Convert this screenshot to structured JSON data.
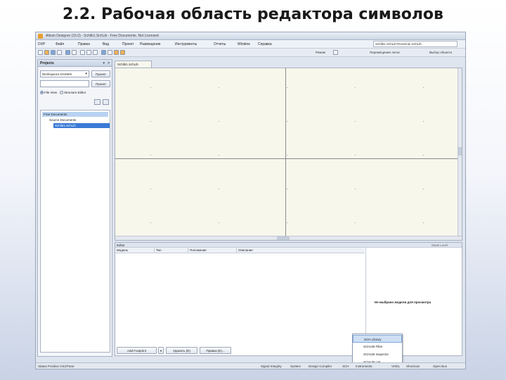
{
  "slide": {
    "title": "2.2. Рабочая область редактора символов"
  },
  "window": {
    "title": "Altium Designer (15.0) - Schlib1.SchLib - Free Documents. Not Licensed"
  },
  "menubar": {
    "items": [
      "DXP",
      "Файл",
      "Правка",
      "Вид",
      "Проект",
      "Размещение",
      "Инструменты",
      "Отчеты",
      "Window",
      "Справка"
    ],
    "path": "Schlib1.SchLib?DocKind=SchLib"
  },
  "toolbar": {
    "scheme_label": "Режим",
    "vis_label": "Перемещение легое",
    "filter_label": "Выбор объекта"
  },
  "projects_panel": {
    "title": "Projects",
    "workspace": "Workspace1.DsnWrk",
    "workspace_button": "Проект",
    "project_button": "Проект",
    "radio_file_view": "File View",
    "radio_structure": "Structure Editor",
    "tree": [
      "Free Documents",
      "Source Documents",
      "Schlib1.SchLib"
    ]
  },
  "document": {
    "tab": "Schlib1.SchLib"
  },
  "editor": {
    "header": "Editor",
    "mask_label": "Mask Level",
    "columns": [
      "Модель",
      "Тип",
      "Положение",
      "Описание"
    ],
    "preview_message": "Не выбрано модели для просмотра",
    "buttons": [
      "Add Footprint",
      "Удалить (D)",
      "Правка (E)..."
    ]
  },
  "popup_menu": {
    "items": [
      "SCH Library",
      "SCHLIB Filter",
      "SCHLIB Inspector",
      "SCHLIB List"
    ]
  },
  "statusbar": {
    "left": "Status  Position  Grid:Pane",
    "right": [
      "Signal Integrity",
      "System",
      "Design Compiler",
      "SCH",
      "Instruments",
      "VHDL",
      "Shortcuts",
      "Open Bus"
    ]
  }
}
